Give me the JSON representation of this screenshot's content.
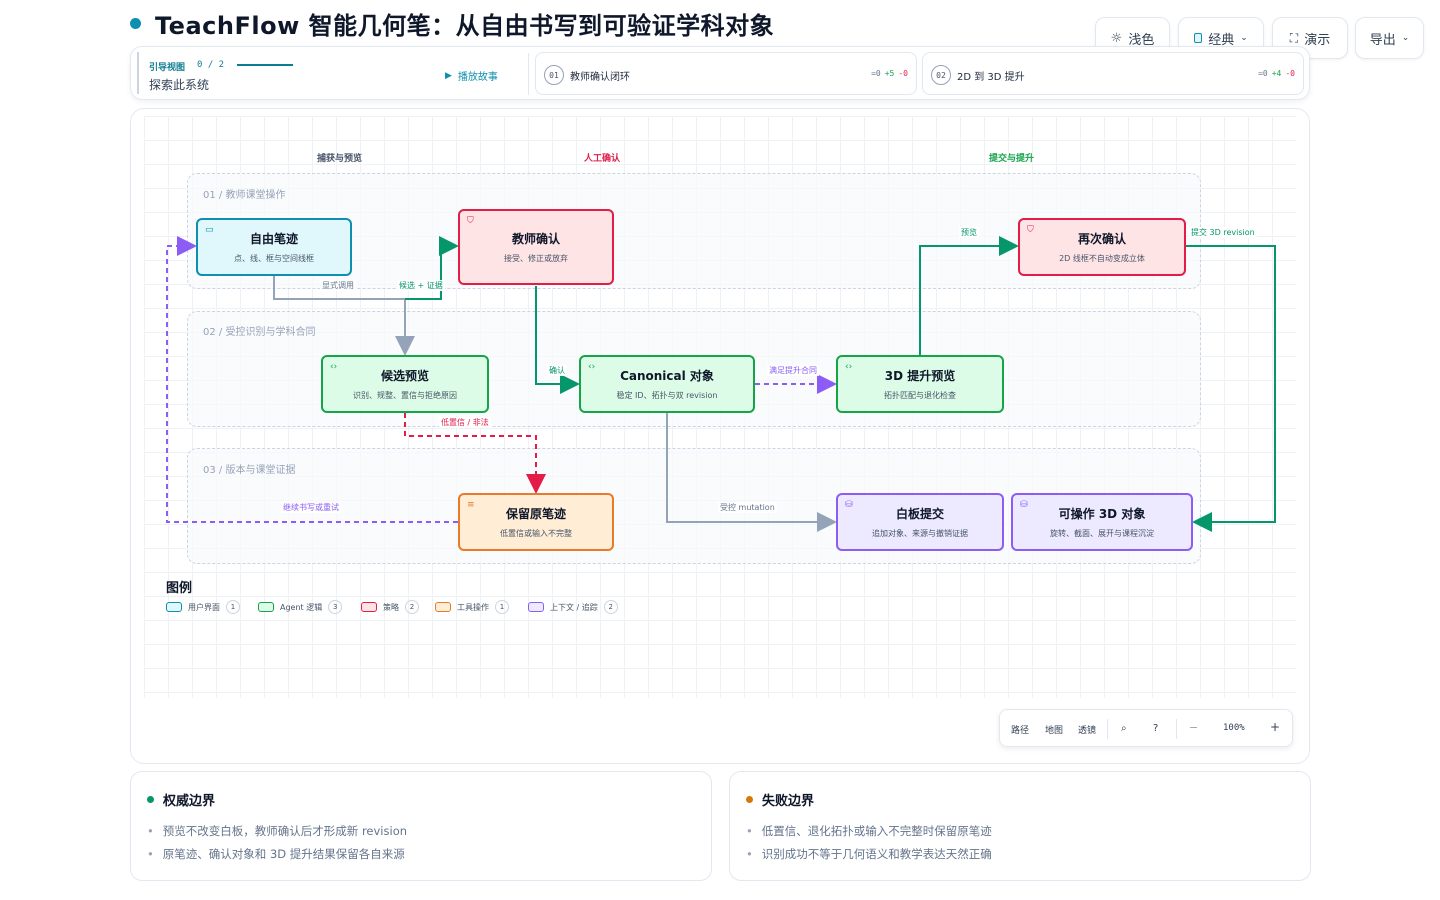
{
  "header": {
    "title": "TeachFlow 智能几何笔：从自由书写到可验证学科对象",
    "buttons": {
      "theme": "浅色",
      "style": "经典",
      "present": "演示",
      "export": "导出"
    }
  },
  "guide": {
    "label": "引导视图",
    "count": "0 / 2",
    "subtitle": "探索此系统",
    "play": "播放故事",
    "steps": [
      {
        "num": "01",
        "title": "教师确认闭环",
        "delta_eq": "=0",
        "delta_plus": "+5",
        "delta_minus": "-0"
      },
      {
        "num": "02",
        "title": "2D 到 3D 提升",
        "delta_eq": "=0",
        "delta_plus": "+4",
        "delta_minus": "-0"
      }
    ]
  },
  "diagram": {
    "lane_headers": [
      "捕获与预览",
      "人工确认",
      "提交与提升"
    ],
    "bands": [
      "01 / 教师课堂操作",
      "02 / 受控识别与学科合同",
      "03 / 版本与课堂证据"
    ],
    "nodes": {
      "free_stroke": {
        "title": "自由笔迹",
        "sub": "点、线、框与空间线框"
      },
      "teacher_confirm": {
        "title": "教师确认",
        "sub": "接受、修正或放弃"
      },
      "reconfirm": {
        "title": "再次确认",
        "sub": "2D 线框不自动变成立体"
      },
      "candidate_preview": {
        "title": "候选预览",
        "sub": "识别、规整、置信与拒绝原因"
      },
      "canonical": {
        "title": "Canonical 对象",
        "sub": "稳定 ID、拓扑与双 revision"
      },
      "preview_3d": {
        "title": "3D 提升预览",
        "sub": "拓扑匹配与退化检查"
      },
      "keep_stroke": {
        "title": "保留原笔迹",
        "sub": "低置信或输入不完整"
      },
      "whiteboard_submit": {
        "title": "白板提交",
        "sub": "追加对象、来源与撤销证据"
      },
      "operable_3d": {
        "title": "可操作 3D 对象",
        "sub": "旋转、截面、展开与课程沉淀"
      }
    },
    "edges": {
      "explicit_call": "显式调用",
      "candidate_evidence": "候选 + 证据",
      "confirm": "确认",
      "satisfy_contract": "满足提升合同",
      "preview": "预览",
      "submit_3d": "提交 3D revision",
      "low_conf": "低置信 / 非法",
      "retry": "继续书写或重试",
      "mutation": "受控 mutation"
    }
  },
  "legend": {
    "title": "图例",
    "items": [
      {
        "label": "用户界面",
        "count": "1",
        "color": "#0e8fb0",
        "fill": "#e0f7fb"
      },
      {
        "label": "Agent 逻辑",
        "count": "3",
        "color": "#16a34a",
        "fill": "#dcfce7"
      },
      {
        "label": "策略",
        "count": "2",
        "color": "#e11d48",
        "fill": "#ffe4e6"
      },
      {
        "label": "工具操作",
        "count": "1",
        "color": "#ea7a2b",
        "fill": "#ffedd5"
      },
      {
        "label": "上下文 / 追踪",
        "count": "2",
        "color": "#8b5cf6",
        "fill": "#ede9fe"
      }
    ]
  },
  "toolbar": {
    "path": "路径",
    "map": "地图",
    "lens": "透镜",
    "zoom": "100%"
  },
  "cards": {
    "authority": {
      "title": "权威边界",
      "items": [
        "预览不改变白板，教师确认后才形成新 revision",
        "原笔迹、确认对象和 3D 提升结果保留各自来源"
      ]
    },
    "failure": {
      "title": "失败边界",
      "items": [
        "低置信、退化拓扑或输入不完整时保留原笔迹",
        "识别成功不等于几何语义和教学表达天然正确"
      ]
    }
  },
  "colors": {
    "accent": "#0e8fb0",
    "agent": "#16a34a",
    "policy": "#e11d48",
    "tool": "#ea7a2b",
    "context": "#8b5cf6"
  }
}
